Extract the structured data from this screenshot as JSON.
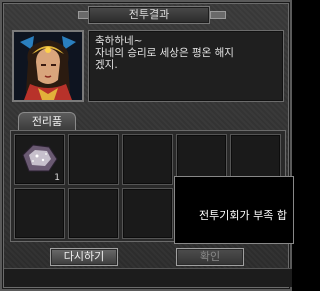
{
  "window": {
    "title": "전투결과"
  },
  "dialog": {
    "lines": [
      "축하하네~",
      "자네의 승리로 세상은 평온 해지",
      "겠지."
    ]
  },
  "rewards": {
    "tab_label": "전리품",
    "slots": [
      {
        "item": "ore-icon",
        "quantity": "1"
      },
      {
        "item": null,
        "quantity": ""
      },
      {
        "item": null,
        "quantity": ""
      },
      {
        "item": null,
        "quantity": ""
      },
      {
        "item": null,
        "quantity": ""
      },
      {
        "item": null,
        "quantity": ""
      },
      {
        "item": null,
        "quantity": ""
      },
      {
        "item": null,
        "quantity": ""
      },
      {
        "item": null,
        "quantity": ""
      },
      {
        "item": null,
        "quantity": ""
      }
    ]
  },
  "tooltip": {
    "text": "전투기회가 부족 합"
  },
  "buttons": {
    "retry_label": "다시하기",
    "confirm_label": "확인"
  },
  "colors": {
    "window_bg": "#2d2d2d",
    "border": "#6a6a6a",
    "text": "#e2e2e2"
  }
}
